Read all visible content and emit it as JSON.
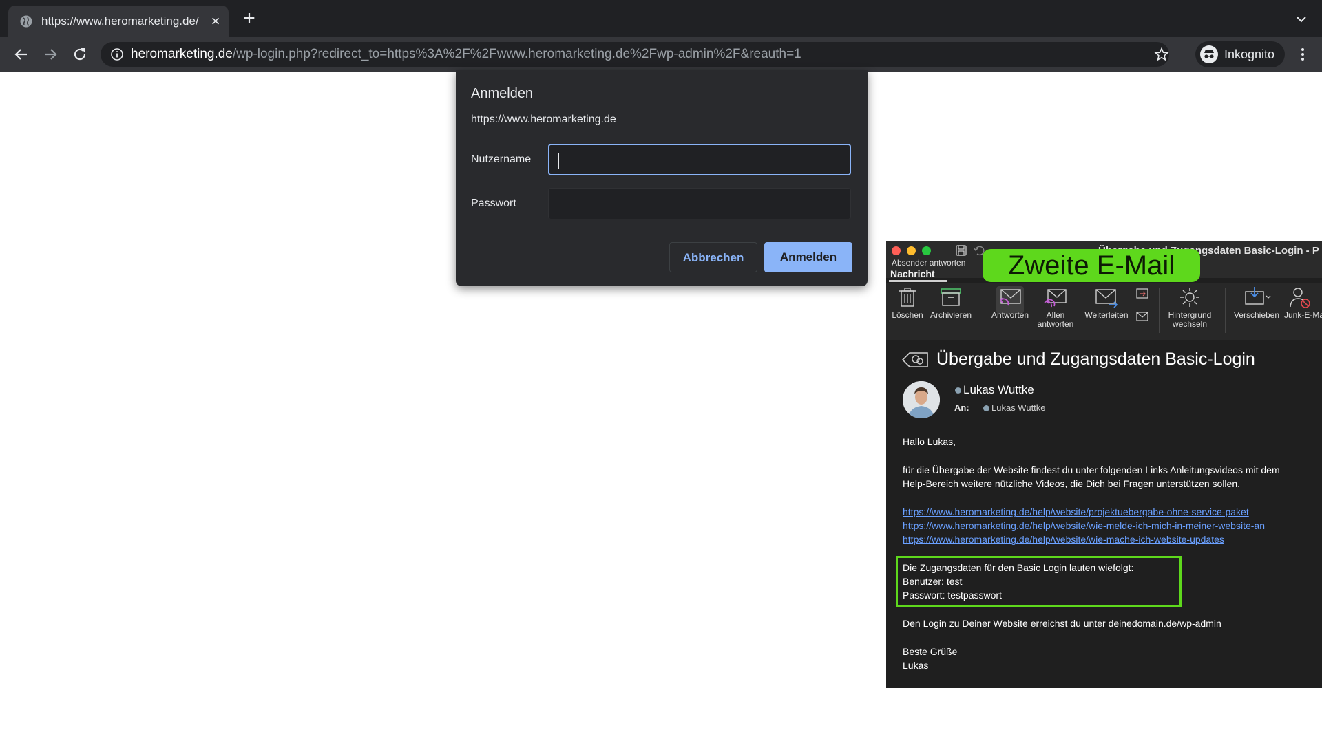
{
  "browser": {
    "tab_title": "https://www.heromarketing.de/",
    "tab_close": "×",
    "new_tab": "+",
    "url_host": "heromarketing.de",
    "url_path": "/wp-login.php?redirect_to=https%3A%2F%2Fwww.heromarketing.de%2Fwp-admin%2F&reauth=1",
    "profile_label": "Inkognito"
  },
  "dialog": {
    "title": "Anmelden",
    "origin": "https://www.heromarketing.de",
    "username_label": "Nutzername",
    "username_value": "",
    "password_label": "Passwort",
    "password_value": "",
    "cancel_label": "Abbrechen",
    "submit_label": "Anmelden",
    "focus_color": "#8ab4f8"
  },
  "mail": {
    "window_title": "Übergabe und Zugangsdaten Basic-Login - P",
    "sender_reply": "Absender antworten",
    "tab_label": "Nachricht",
    "banner": "Zweite E-Mail",
    "ribbon": {
      "delete": "Löschen",
      "archive": "Archivieren",
      "reply": "Antworten",
      "reply_all_1": "Allen",
      "reply_all_2": "antworten",
      "forward": "Weiterleiten",
      "background_1": "Hintergrund",
      "background_2": "wechseln",
      "move": "Verschieben",
      "junk": "Junk-E-Mail"
    },
    "subject": "Übergabe und Zugangsdaten Basic-Login",
    "from": "Lukas Wuttke",
    "to_label": "An:",
    "to": "Lukas Wuttke",
    "greeting": "Hallo Lukas,",
    "intro_1": "für die Übergabe der Website findest du unter folgenden Links Anleitungsvideos mit dem",
    "intro_2": "Help-Bereich weitere nützliche Videos, die Dich bei Fragen unterstützen sollen.",
    "links": [
      "https://www.heromarketing.de/help/website/projektuebergabe-ohne-service-paket",
      "https://www.heromarketing.de/help/website/wie-melde-ich-mich-in-meiner-website-an",
      "https://www.heromarketing.de/help/website/wie-mache-ich-website-updates"
    ],
    "credentials_intro": "Die Zugangsdaten für den Basic Login lauten wiefolgt:",
    "credentials_user": "Benutzer: test",
    "credentials_password": "Passwort: testpasswort",
    "login_hint": "Den Login zu Deiner Website erreichst du unter deinedomain.de/wp-admin",
    "closing": "Beste Grüße",
    "signature": "Lukas",
    "highlight_color": "#5ed81c"
  }
}
